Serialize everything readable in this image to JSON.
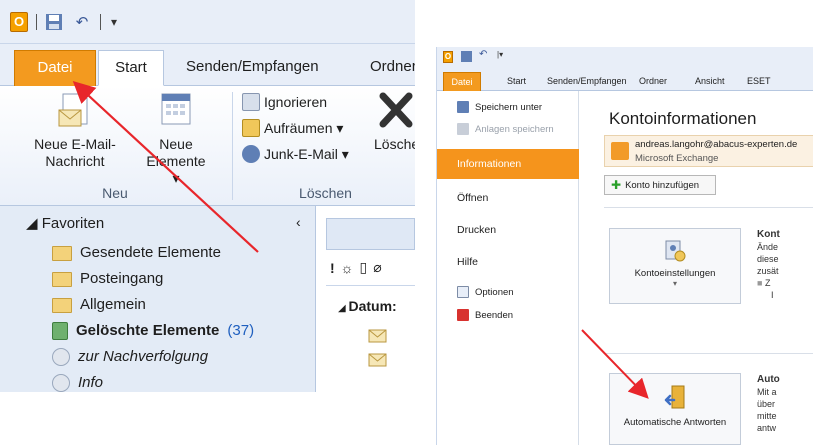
{
  "left": {
    "tabs": {
      "file": "Datei",
      "start": "Start",
      "send": "Senden/Empfangen",
      "folder": "Ordner"
    },
    "ribbon": {
      "new_mail": "Neue E-Mail-Nachricht",
      "new_items": "Neue Elemente ▾",
      "group_new": "Neu",
      "ignore": "Ignorieren",
      "cleanup": "Aufräumen ▾",
      "junk": "Junk-E-Mail ▾",
      "delete": "Lösche",
      "group_delete": "Löschen"
    },
    "nav": {
      "favorites": "◢ Favoriten",
      "items": [
        "Gesendete Elemente",
        "Posteingang",
        "Allgemein"
      ],
      "deleted": "Gelöschte Elemente",
      "deleted_count": "(37)",
      "followup": "zur Nachverfolgung",
      "info": "Info"
    },
    "list": {
      "group": "Datum:"
    }
  },
  "right": {
    "tabs": [
      "Datei",
      "Start",
      "Senden/Empfangen",
      "Ordner",
      "Ansicht",
      "ESET"
    ],
    "backstage": {
      "save_as": "Speichern unter",
      "save_attachments": "Anlagen speichern",
      "info": "Informationen",
      "open": "Öffnen",
      "print": "Drucken",
      "help": "Hilfe",
      "options": "Optionen",
      "exit": "Beenden"
    },
    "content": {
      "title": "Kontoinformationen",
      "account_email": "andreas.langohr@abacus-experten.de",
      "account_type": "Microsoft Exchange",
      "add_account": "Konto hinzufügen",
      "account_settings": "Kontoeinstellungen",
      "settings_caret": "▾",
      "settings_heading": "Kont",
      "settings_lines": [
        "Ände",
        "diese",
        "zusät"
      ],
      "bullet_a": "Z",
      "bullet_b": "I",
      "auto_replies": "Automatische Antworten",
      "auto_heading": "Auto",
      "auto_lines": [
        "Mit a",
        "über",
        "mitte",
        "antw"
      ]
    }
  },
  "colors": {
    "accent": "#f39a1f",
    "arrow": "#e8262b"
  }
}
